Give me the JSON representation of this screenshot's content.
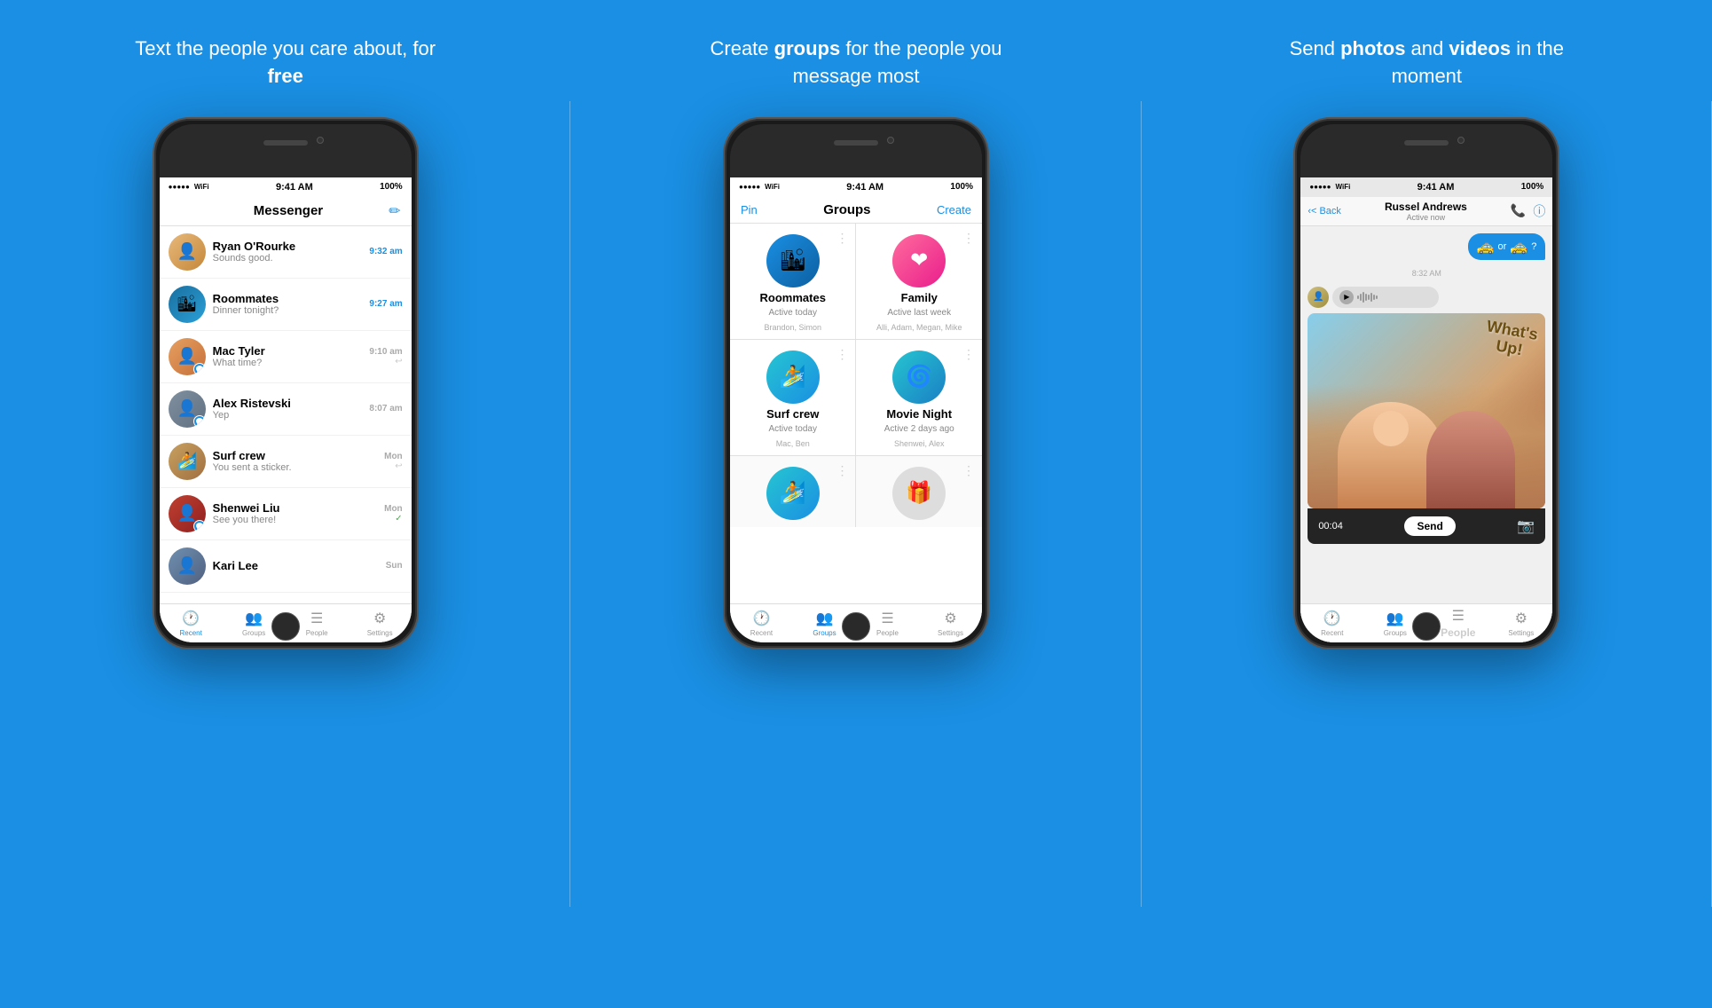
{
  "panels": [
    {
      "id": "panel1",
      "title_parts": [
        "Text the people you care about, for ",
        "free"
      ],
      "title_plain": "Text the people you care about, for free",
      "bold_word": "free"
    },
    {
      "id": "panel2",
      "title_parts": [
        "Create ",
        "groups",
        " for the people you message most"
      ],
      "bold_word": "groups"
    },
    {
      "id": "panel3",
      "title_parts": [
        "Send ",
        "photos",
        " and ",
        "videos",
        " in the moment"
      ],
      "bold_words": [
        "photos",
        "videos"
      ]
    }
  ],
  "phone1": {
    "status": {
      "dots": "●●●●●",
      "wifi": "WiFi",
      "time": "9:41 AM",
      "battery": "100%"
    },
    "header": {
      "title": "Messenger",
      "edit_icon": "✏"
    },
    "chats": [
      {
        "id": "ryan",
        "name": "Ryan O'Rourke",
        "preview": "Sounds good.",
        "time": "9:32 am",
        "time_blue": true,
        "avatar_class": "av-ryan",
        "has_badge": false
      },
      {
        "id": "roommates",
        "name": "Roommates",
        "preview": "Dinner tonight?",
        "time": "9:27 am",
        "time_blue": true,
        "avatar_class": "av-roommates",
        "has_badge": false
      },
      {
        "id": "mac",
        "name": "Mac Tyler",
        "preview": "What time?",
        "time": "9:10 am",
        "time_blue": false,
        "avatar_class": "av-mac",
        "has_badge": true,
        "has_reply": true
      },
      {
        "id": "alex",
        "name": "Alex Ristevski",
        "preview": "Yep",
        "time": "8:07 am",
        "time_blue": false,
        "avatar_class": "av-alex",
        "has_badge": true
      },
      {
        "id": "surf",
        "name": "Surf crew",
        "preview": "You sent a sticker.",
        "time": "Mon",
        "time_blue": false,
        "avatar_class": "av-surf",
        "has_reply": true
      },
      {
        "id": "shenwei",
        "name": "Shenwei Liu",
        "preview": "See you there!",
        "time": "Mon",
        "time_blue": false,
        "avatar_class": "av-shenwei",
        "has_badge": true,
        "has_check": true
      },
      {
        "id": "kari",
        "name": "Kari Lee",
        "preview": "",
        "time": "Sun",
        "time_blue": false,
        "avatar_class": "av-kari"
      }
    ],
    "tabs": [
      {
        "id": "recent",
        "label": "Recent",
        "icon": "🕐",
        "active": true
      },
      {
        "id": "groups",
        "label": "Groups",
        "icon": "👥",
        "active": false
      },
      {
        "id": "people",
        "label": "People",
        "icon": "☰",
        "active": false
      },
      {
        "id": "settings",
        "label": "Settings",
        "icon": "⚙",
        "active": false
      }
    ]
  },
  "phone2": {
    "status": {
      "time": "9:41 AM",
      "battery": "100%"
    },
    "header": {
      "pin": "Pin",
      "title": "Groups",
      "create": "Create"
    },
    "groups": [
      {
        "id": "roommates",
        "name": "Roommates",
        "status": "Active today",
        "members": "Brandon, Simon",
        "circle_class": "circle-roommates",
        "icon": "🏙"
      },
      {
        "id": "family",
        "name": "Family",
        "status": "Active last week",
        "members": "Alli, Adam, Megan, Mike",
        "circle_class": "circle-family",
        "icon": "❤"
      },
      {
        "id": "surf",
        "name": "Surf crew",
        "status": "Active today",
        "members": "Mac, Ben",
        "circle_class": "circle-surf",
        "icon": "🏄"
      },
      {
        "id": "movienight",
        "name": "Movie Night",
        "status": "Active 2 days ago",
        "members": "Shenwei, Alex",
        "circle_class": "circle-movienight",
        "icon": "🌀"
      }
    ],
    "tabs": [
      {
        "id": "recent",
        "label": "Recent",
        "icon": "🕐",
        "active": false
      },
      {
        "id": "groups",
        "label": "Groups",
        "icon": "👥",
        "active": true
      },
      {
        "id": "people",
        "label": "People",
        "icon": "☰",
        "active": false
      },
      {
        "id": "settings",
        "label": "Settings",
        "icon": "⚙",
        "active": false
      }
    ]
  },
  "phone3": {
    "status": {
      "time": "9:41 AM",
      "battery": "100%"
    },
    "header": {
      "back": "< Back",
      "contact_name": "Russel Andrews",
      "contact_status": "Active now",
      "call_icon": "📞",
      "info_icon": "ⓘ"
    },
    "messages": {
      "time_label": "8:32 AM",
      "audio_bubble": true,
      "photo_sticker": "What's Up!",
      "video_timer": "00:04",
      "send_label": "Send"
    },
    "tabs": [
      {
        "id": "recent",
        "label": "Recent",
        "icon": "🕐",
        "active": false
      },
      {
        "id": "groups",
        "label": "Groups",
        "icon": "👥",
        "active": false
      },
      {
        "id": "people",
        "label": "People",
        "icon": "☰",
        "active": false
      },
      {
        "id": "settings",
        "label": "Settings",
        "icon": "⚙",
        "active": false
      }
    ]
  }
}
